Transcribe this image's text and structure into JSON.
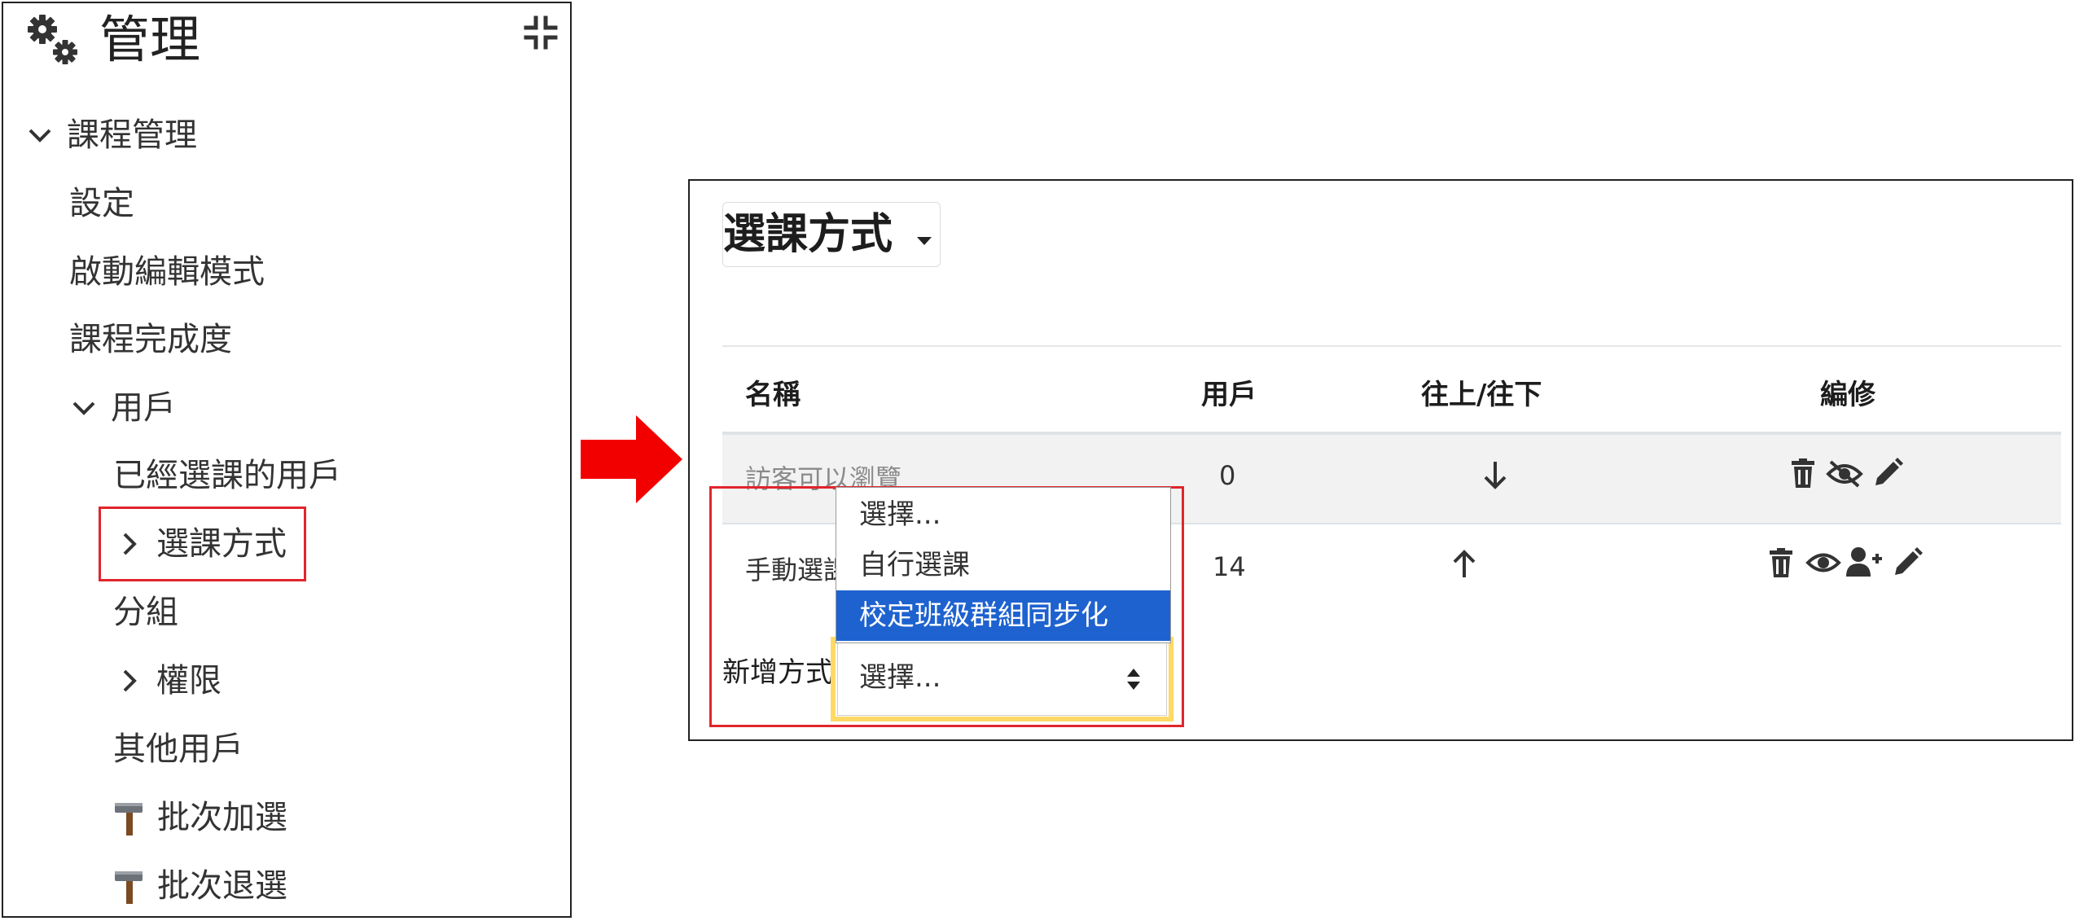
{
  "admin": {
    "title": "管理",
    "nav": {
      "course_admin": "課程管理",
      "settings": "設定",
      "edit_mode": "啟動編輯模式",
      "completion": "課程完成度",
      "users": "用戶",
      "enrolled_users": "已經選課的用戶",
      "enrol_methods": "選課方式",
      "groups": "分組",
      "permissions": "權限",
      "other_users": "其他用戶",
      "bulk_add": "批次加選",
      "bulk_drop": "批次退選"
    }
  },
  "enrolment": {
    "heading": "選課方式",
    "columns": {
      "name": "名稱",
      "users": "用戶",
      "move": "往上/往下",
      "edit": "編修"
    },
    "rows": [
      {
        "name": "訪客可以瀏覽",
        "users": "0"
      },
      {
        "name": "手動選課",
        "users": "14"
      }
    ],
    "add_method_label": "新增方式",
    "select_value": "選擇...",
    "dropdown_options": [
      "選擇...",
      "自行選課",
      "校定班級群組同步化"
    ],
    "dropdown_selected_index": 2
  },
  "colors": {
    "highlight_red": "#e0262b",
    "highlight_yellow": "#ffd966",
    "selected_option": "#1e62d0",
    "arrow": "#f20000"
  },
  "icons": [
    "cogs-icon",
    "collapse-icon",
    "chevron-down-icon",
    "chevron-right-icon",
    "hammer-icon",
    "arrow-down-icon",
    "arrow-up-icon",
    "trash-icon",
    "eye-slash-icon",
    "eye-icon",
    "user-plus-icon",
    "pencil-icon",
    "caret-down-icon",
    "select-updown-icon"
  ]
}
